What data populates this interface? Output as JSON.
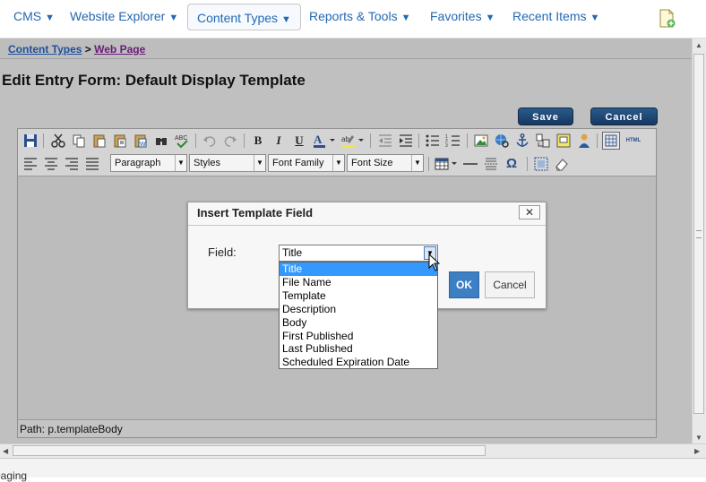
{
  "nav": {
    "items": [
      {
        "label": "CMS"
      },
      {
        "label": "Website Explorer"
      },
      {
        "label": "Content Types"
      },
      {
        "label": "Reports & Tools"
      },
      {
        "label": "Favorites"
      },
      {
        "label": "Recent Items"
      }
    ],
    "caret": "▼"
  },
  "breadcrumb": {
    "parent": "Content Types",
    "sep": " > ",
    "current": "Web Page"
  },
  "page": {
    "title": "Edit Entry Form: Default Display Template"
  },
  "actions": {
    "save": "Save",
    "cancel": "Cancel"
  },
  "toolbar": {
    "paragraph": "Paragraph",
    "styles": "Styles",
    "font_family": "Font Family",
    "font_size": "Font Size",
    "bold": "B",
    "italic": "I",
    "underline": "U",
    "html": "HTML",
    "omega": "Ω"
  },
  "editor": {
    "path": "Path: p.templateBody"
  },
  "dialog": {
    "title": "Insert Template Field",
    "close": "✕",
    "field_label": "Field:",
    "selected": "Title",
    "ok": "OK",
    "cancel": "Cancel",
    "options": [
      "Title",
      "File Name",
      "Template",
      "Description",
      "Body",
      "First Published",
      "Last Published",
      "Scheduled Expiration Date"
    ]
  },
  "status": {
    "text": "paging"
  },
  "colors": {
    "accent": "#2468b3",
    "selection": "#3399ff",
    "dark_button": "#1f4a78"
  }
}
